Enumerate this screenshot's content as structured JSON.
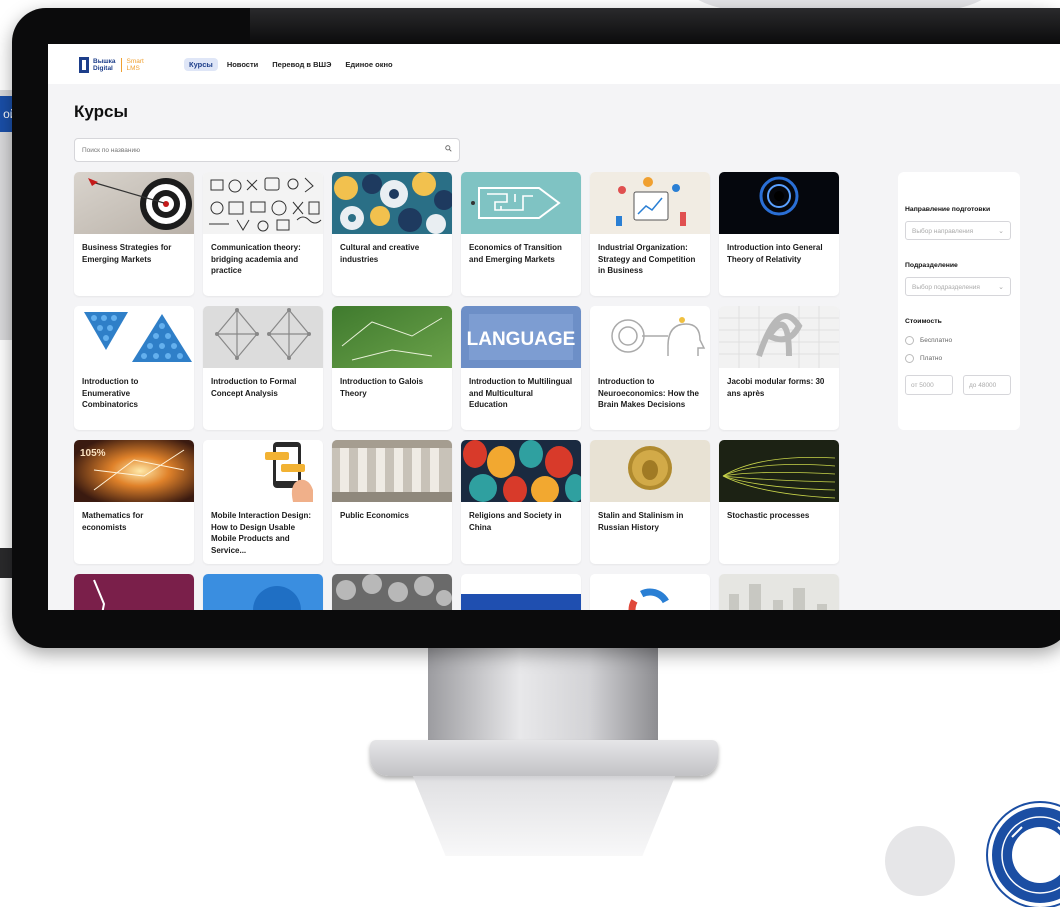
{
  "background": {
    "left_button_label": "ойт"
  },
  "app": {
    "logo": {
      "line1": "Вышка",
      "line2": "Digital",
      "sub1": "Smart",
      "sub2": "LMS"
    },
    "nav": [
      "Курсы",
      "Новости",
      "Перевод в ВШЭ",
      "Единое окно"
    ],
    "page_title": "Курсы",
    "search": {
      "placeholder": "Поиск по названию"
    },
    "courses": [
      {
        "title": "Business Strategies for Emerging Markets"
      },
      {
        "title": "Communication theory: bridging academia and practice"
      },
      {
        "title": "Cultural and creative industries"
      },
      {
        "title": "Economics of Transition and Emerging Markets"
      },
      {
        "title": "Industrial Organization: Strategy and Competition in Business"
      },
      {
        "title": "Introduction into General Theory of Relativity"
      },
      {
        "title": "Introduction to Enumerative Combinatorics"
      },
      {
        "title": "Introduction to Formal Concept Analysis"
      },
      {
        "title": "Introduction to Galois Theory"
      },
      {
        "title": "Introduction to Multilingual and Multicultural Education"
      },
      {
        "title": "Introduction to Neuroeconomics: How the Brain Makes Decisions"
      },
      {
        "title": "Jacobi modular forms: 30 ans après"
      },
      {
        "title": "Mathematics for economists"
      },
      {
        "title": "Mobile Interaction Design: How to Design Usable Mobile Products and Service..."
      },
      {
        "title": "Public Economics"
      },
      {
        "title": "Religions and Society in China"
      },
      {
        "title": "Stalin and Stalinism in Russian History"
      },
      {
        "title": "Stochastic processes"
      }
    ],
    "thumb_texts": {
      "language": "LANGUAGE",
      "percent": "105%"
    },
    "filters": {
      "direction_label": "Направление подготовки",
      "direction_placeholder": "Выбор направления",
      "department_label": "Подразделение",
      "department_placeholder": "Выбор подразделения",
      "cost_label": "Стоимость",
      "free_label": "Бесплатно",
      "paid_label": "Платно",
      "price_from": "от 5000",
      "price_to": "до 48000"
    }
  },
  "colors": {
    "accent": "#1d3e8a",
    "nav_active_bg": "#dfe6f7",
    "logo_orange": "#f0a030"
  }
}
